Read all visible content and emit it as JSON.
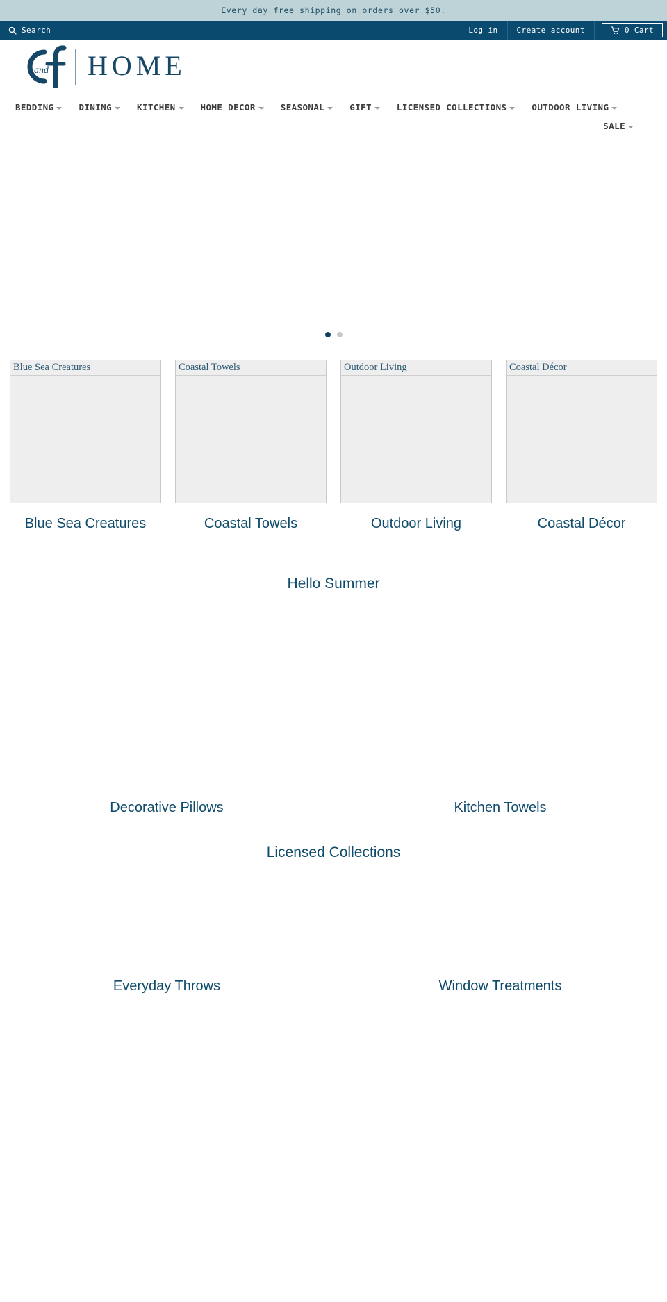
{
  "announcement": {
    "text": "Every day free shipping on orders over $50."
  },
  "utility_bar": {
    "search_label": "Search",
    "search_icon": "search-icon",
    "login_label": "Log in",
    "create_account_label": "Create account",
    "cart_icon": "shopping-cart-icon",
    "cart_label": "0 Cart",
    "cart_count": 0
  },
  "logo": {
    "mark_letters": "C and f",
    "word": "HOME",
    "alt": "C and F Home"
  },
  "nav": {
    "row1": [
      {
        "label": "BEDDING",
        "has_dropdown": true
      },
      {
        "label": "DINING",
        "has_dropdown": true
      },
      {
        "label": "KITCHEN",
        "has_dropdown": true
      },
      {
        "label": "HOME DECOR",
        "has_dropdown": true
      },
      {
        "label": "SEASONAL",
        "has_dropdown": true
      },
      {
        "label": "GIFT",
        "has_dropdown": true
      },
      {
        "label": "LICENSED COLLECTIONS",
        "has_dropdown": true
      },
      {
        "label": "OUTDOOR LIVING",
        "has_dropdown": true
      }
    ],
    "row2": [
      {
        "label": "SALE",
        "has_dropdown": true
      }
    ]
  },
  "hero": {
    "slide_count": 2,
    "active_slide": 1,
    "dots": [
      {
        "label": "1",
        "active": true
      },
      {
        "label": "2",
        "active": false
      }
    ]
  },
  "collections": [
    {
      "label": "Blue Sea Creatures",
      "alt": "Blue Sea Creatures"
    },
    {
      "label": "Coastal Towels",
      "alt": "Coastal Towels"
    },
    {
      "label": "Outdoor Living",
      "alt": "Outdoor Living"
    },
    {
      "label": "Coastal Décor",
      "alt": "Coastal Décor"
    }
  ],
  "sections": [
    {
      "heading": "Hello Summer",
      "tiles": [
        {
          "label": "Decorative Pillows"
        },
        {
          "label": "Kitchen Towels"
        }
      ]
    },
    {
      "heading": "Licensed Collections",
      "tiles": [
        {
          "label": "Everyday Throws"
        },
        {
          "label": "Window Treatments"
        }
      ]
    }
  ],
  "colors": {
    "announcement_bg": "#bdd3d7",
    "announcement_text": "#214e63",
    "header_bg": "#0b4a6f",
    "brand_navy": "#0f4b6b",
    "logo_navy": "#174766",
    "nav_text": "#3c3c3c",
    "dot_active": "#0d3f5e",
    "dot_inactive": "#c7c7c7",
    "placeholder_bg": "#eeeeee"
  }
}
